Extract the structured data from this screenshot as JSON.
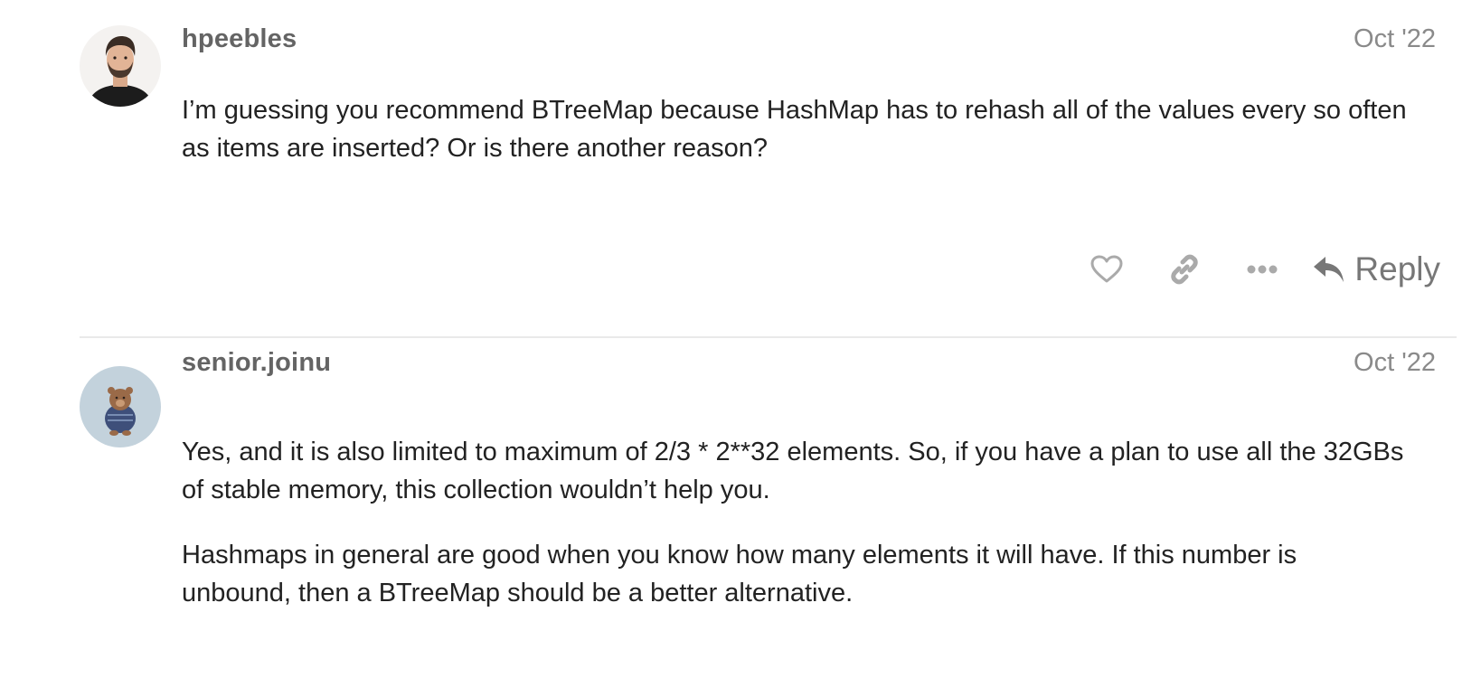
{
  "posts": [
    {
      "username": "hpeebles",
      "date": "Oct '22",
      "paragraphs": [
        "I’m guessing you recommend BTreeMap because HashMap has to rehash all of the values every so often as items are inserted? Or is there another reason?"
      ]
    },
    {
      "username": "senior.joinu",
      "date": "Oct '22",
      "paragraphs": [
        "Yes, and it is also limited to maximum of 2/3 * 2**32 elements. So, if you have a plan to use all the 32GBs of stable memory, this collection wouldn’t help you.",
        "Hashmaps in general are good when you know how many elements it will have. If this number is unbound, then a BTreeMap should be a better alternative."
      ]
    }
  ],
  "actions": {
    "like_icon": "heart-icon",
    "link_icon": "link-icon",
    "more_icon": "ellipsis-icon",
    "reply_icon": "reply-arrow-icon",
    "reply_label": "Reply"
  },
  "colors": {
    "username": "#646464",
    "date": "#8a8a8a",
    "text": "#222222",
    "icon": "#aaaaaa",
    "reply": "#777777",
    "divider": "#e9e9e9",
    "avatar2_bg": "#c3d2dc"
  }
}
